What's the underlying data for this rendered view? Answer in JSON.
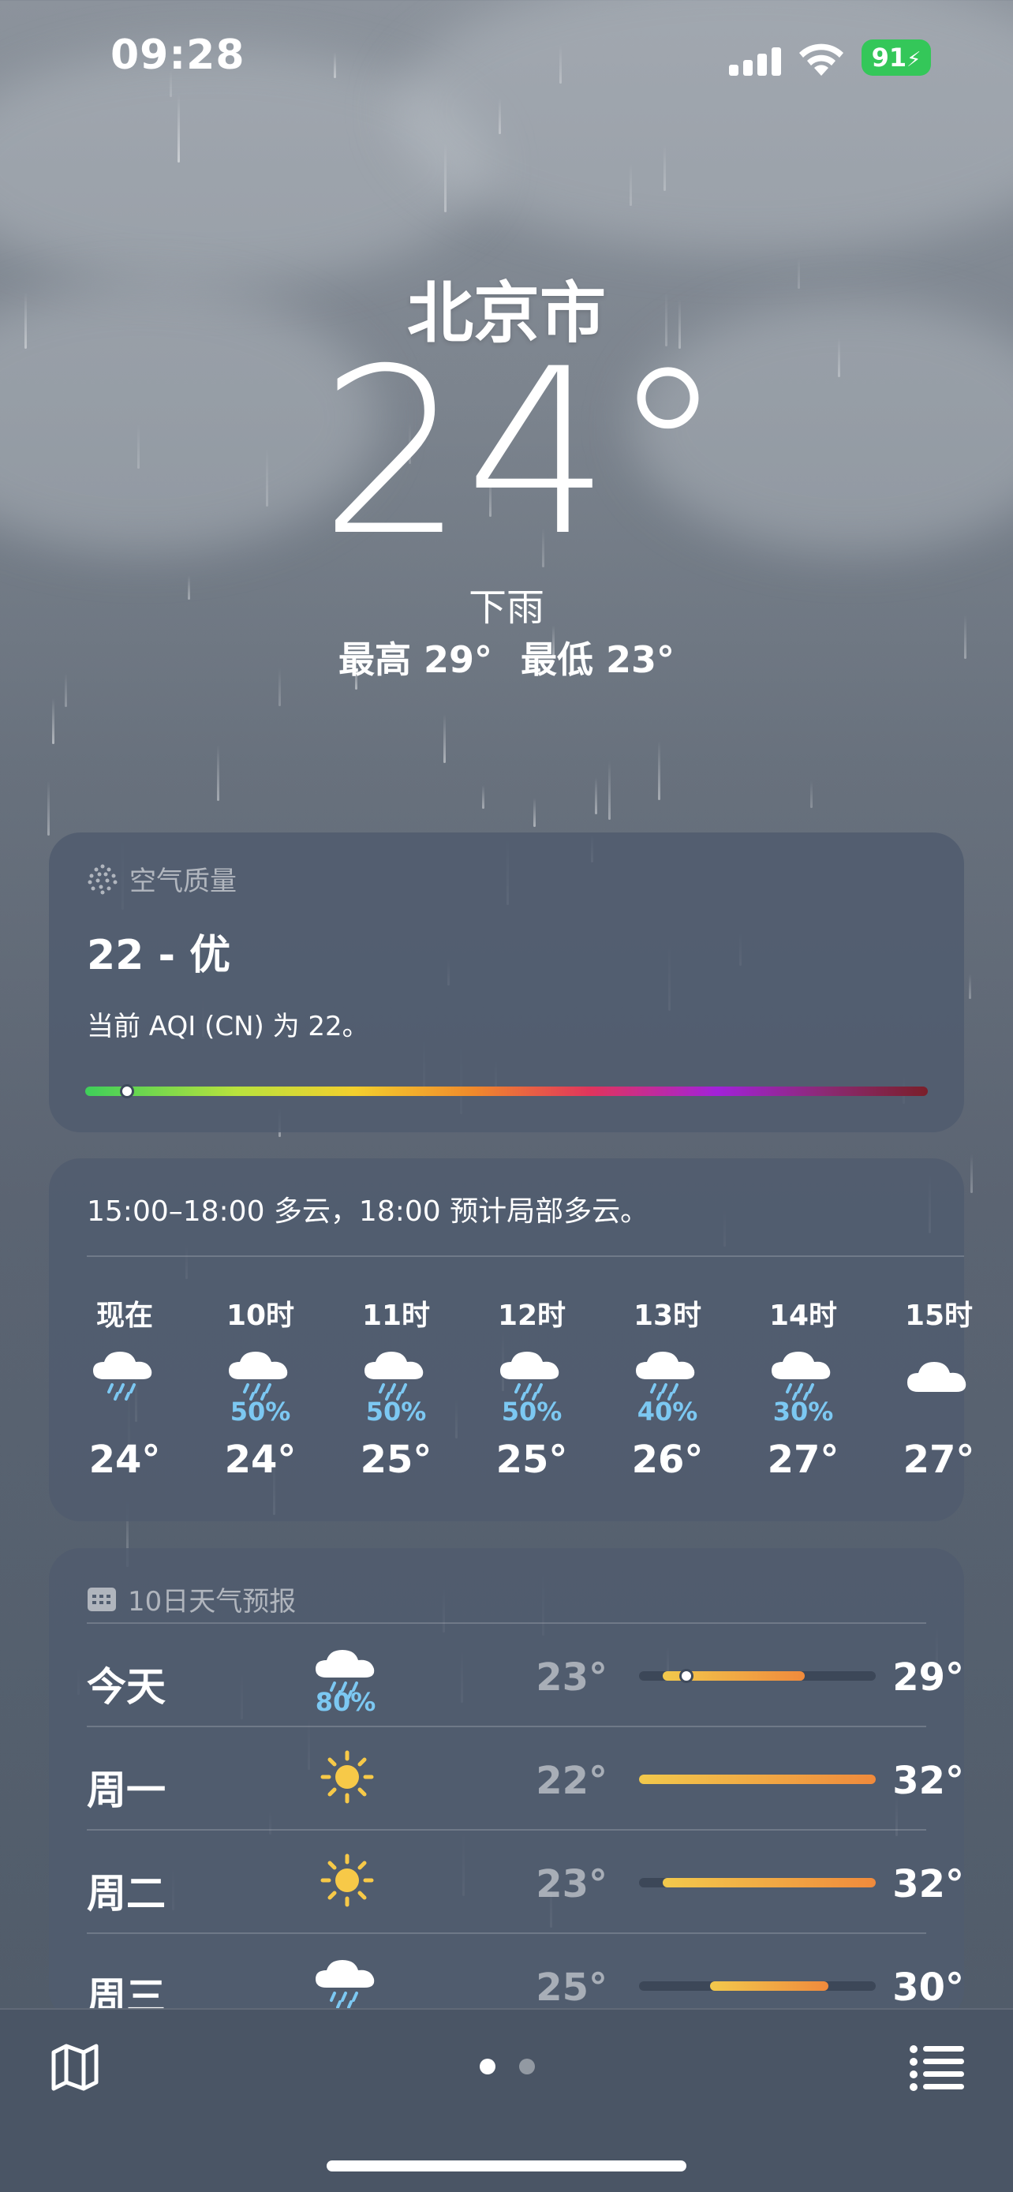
{
  "status_bar": {
    "time": "09:28",
    "battery": "91"
  },
  "location": {
    "city": "北京市",
    "temperature": "24°",
    "condition": "下雨",
    "high": "最高 29°",
    "low": "最低 23°"
  },
  "air_quality": {
    "title": "空气质量",
    "value": "22 - 优",
    "description": "当前 AQI (CN) 为 22。",
    "index_fraction": 0.05
  },
  "hourly": {
    "summary": "15:00–18:00 多云，18:00 预计局部多云。",
    "items": [
      {
        "label": "现在",
        "icon": "rain-cloud-icon",
        "precip": "",
        "temp": "24°"
      },
      {
        "label": "10时",
        "icon": "rain-cloud-icon",
        "precip": "50%",
        "temp": "24°"
      },
      {
        "label": "11时",
        "icon": "rain-cloud-icon",
        "precip": "50%",
        "temp": "25°"
      },
      {
        "label": "12时",
        "icon": "rain-cloud-icon",
        "precip": "50%",
        "temp": "25°"
      },
      {
        "label": "13时",
        "icon": "rain-cloud-icon",
        "precip": "40%",
        "temp": "26°"
      },
      {
        "label": "14时",
        "icon": "rain-cloud-icon",
        "precip": "30%",
        "temp": "27°"
      },
      {
        "label": "15时",
        "icon": "cloud-icon",
        "precip": "",
        "temp": "27°"
      }
    ]
  },
  "daily": {
    "title": "10日天气预报",
    "range": [
      22,
      32
    ],
    "items": [
      {
        "day": "今天",
        "icon": "rain-cloud-icon",
        "precip": "80%",
        "low": "23°",
        "high": "29°",
        "low_val": 23,
        "high_val": 29,
        "current": 24
      },
      {
        "day": "周一",
        "icon": "sun-icon",
        "precip": "",
        "low": "22°",
        "high": "32°",
        "low_val": 22,
        "high_val": 32
      },
      {
        "day": "周二",
        "icon": "sun-icon",
        "precip": "",
        "low": "23°",
        "high": "32°",
        "low_val": 23,
        "high_val": 32
      },
      {
        "day": "周三",
        "icon": "rain-cloud-icon",
        "precip": "",
        "low": "25°",
        "high": "30°",
        "low_val": 25,
        "high_val": 30
      }
    ]
  },
  "colors": {
    "precip_blue": "#7cc8f2",
    "temp_bar_start": "#f2c94c",
    "temp_bar_end": "#f08a3c",
    "battery_green": "#34c759"
  }
}
